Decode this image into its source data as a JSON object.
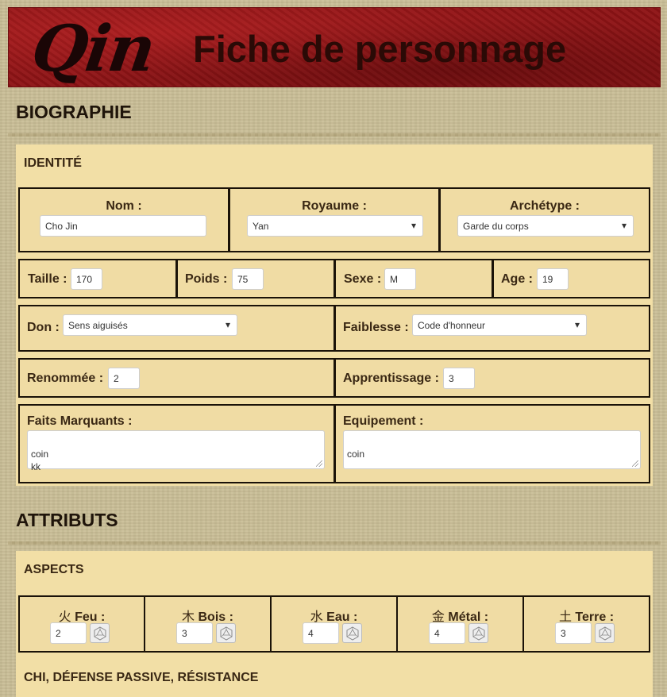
{
  "header": {
    "logo": "Qin",
    "title": "Fiche de personnage"
  },
  "sections": {
    "biographie": "BIOGRAPHIE",
    "attributs": "ATTRIBUTS"
  },
  "identite": {
    "heading": "IDENTITÉ",
    "nom": {
      "label": "Nom :",
      "value": "Cho Jin"
    },
    "royaume": {
      "label": "Royaume :",
      "value": "Yan"
    },
    "archetype": {
      "label": "Archétype :",
      "value": "Garde du corps"
    },
    "taille": {
      "label": "Taille :",
      "value": "170"
    },
    "poids": {
      "label": "Poids :",
      "value": "75"
    },
    "sexe": {
      "label": "Sexe :",
      "value": "M"
    },
    "age": {
      "label": "Age :",
      "value": "19"
    },
    "don": {
      "label": "Don :",
      "value": "Sens aiguisés"
    },
    "faiblesse": {
      "label": "Faiblesse :",
      "value": "Code d'honneur"
    },
    "renommee": {
      "label": "Renommée :",
      "value": "2"
    },
    "apprentissage": {
      "label": "Apprentissage :",
      "value": "3"
    },
    "faits": {
      "label": "Faits Marquants :",
      "value": "coin\nkk"
    },
    "equipement": {
      "label": "Equipement :",
      "value": "coin"
    }
  },
  "aspects": {
    "heading": "ASPECTS",
    "items": [
      {
        "glyph": "火",
        "label": "Feu :",
        "value": "2"
      },
      {
        "glyph": "木",
        "label": "Bois :",
        "value": "3"
      },
      {
        "glyph": "水",
        "label": "Eau :",
        "value": "4"
      },
      {
        "glyph": "金",
        "label": "Métal :",
        "value": "4"
      },
      {
        "glyph": "土",
        "label": "Terre :",
        "value": "3"
      }
    ]
  },
  "chi": {
    "heading": "CHI, DÉFENSE PASSIVE, RÉSISTANCE"
  },
  "icons": {
    "dice": "d20-dice-icon",
    "select": "chevron-down-icon"
  },
  "colors": {
    "banner": "#8f1416",
    "panel": "#f2dfa6",
    "parchment": "#c9bd96",
    "border": "#1a1208"
  }
}
